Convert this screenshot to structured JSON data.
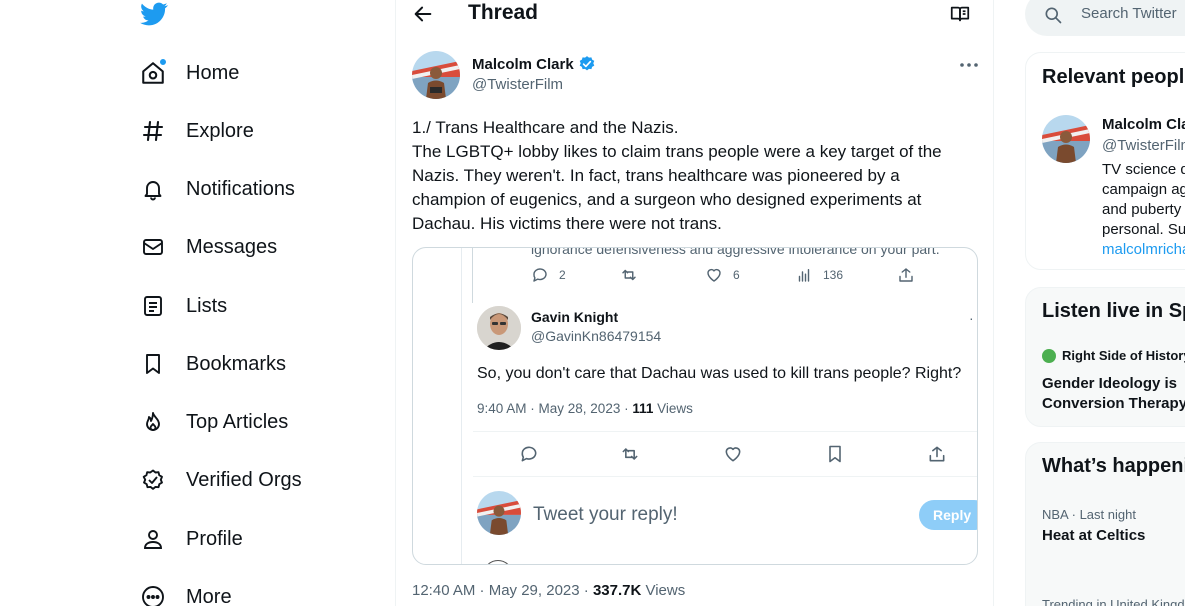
{
  "sidebar": {
    "items": [
      {
        "label": "Home",
        "icon": "home-icon"
      },
      {
        "label": "Explore",
        "icon": "hashtag-icon"
      },
      {
        "label": "Notifications",
        "icon": "bell-icon"
      },
      {
        "label": "Messages",
        "icon": "envelope-icon"
      },
      {
        "label": "Lists",
        "icon": "list-icon"
      },
      {
        "label": "Bookmarks",
        "icon": "bookmark-icon"
      },
      {
        "label": "Top Articles",
        "icon": "flame-icon"
      },
      {
        "label": "Verified Orgs",
        "icon": "verified-badge-icon"
      },
      {
        "label": "Profile",
        "icon": "person-icon"
      },
      {
        "label": "More",
        "icon": "more-circle-icon"
      }
    ]
  },
  "header": {
    "title": "Thread"
  },
  "tweet": {
    "author_name": "Malcolm Clark",
    "author_handle": "@TwisterFilm",
    "lines": [
      "1./ Trans Healthcare and the Nazis.",
      "The LGBTQ+ lobby likes to claim trans people were a key target of the",
      "Nazis. They weren't. In fact, trans healthcare was pioneered by a",
      "champion of eugenics, and a surgeon who designed experiments at",
      "Dachau. His victims there were not trans."
    ],
    "time": "12:40 AM · May 29, 2023 · ",
    "views_count": "337.7K",
    "views_label": " Views"
  },
  "media": {
    "cut_text": "ignorance defensiveness and aggressive intolerance on your part.",
    "stats": {
      "replies": "2",
      "likes": "6",
      "views": "136"
    },
    "reply_author": "Gavin Knight",
    "reply_handle": "@GavinKn86479154",
    "reply_text": "So, you don't care that Dachau was used to kill trans people? Right?",
    "reply_time": "9:40 AM · May 28, 2023 · ",
    "reply_views_count": "111",
    "reply_views_label": " Views",
    "dot": "·",
    "reply_placeholder": "Tweet your reply!",
    "reply_button": "Reply"
  },
  "search": {
    "placeholder": "Search Twitter"
  },
  "relevant": {
    "title": "Relevant people",
    "name": "Malcolm Clark",
    "handle": "@TwisterFilm",
    "bio_lines": [
      "TV science doc",
      "campaign against",
      "and puberty blockers",
      "personal. Sub"
    ],
    "link": "malcolmrichardclark"
  },
  "spaces": {
    "title": "Listen live in Spaces",
    "host": "Right Side of History",
    "title_lines": [
      "Gender Ideology is",
      "Conversion Therapy"
    ]
  },
  "trends": {
    "title": "What’s happening",
    "meta": "NBA · Last night",
    "topic": "Heat at Celtics",
    "meta2": "Trending in United Kingdom"
  }
}
